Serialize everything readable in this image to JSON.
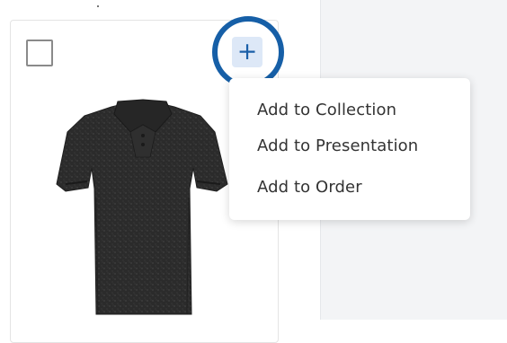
{
  "product_card": {
    "add_button_symbol": "+",
    "product_image_icon": "polo-shirt-icon",
    "shirt_color": "#2c2c2c"
  },
  "add_menu": {
    "items": [
      {
        "label": "Add to Collection"
      },
      {
        "label": "Add to Presentation"
      },
      {
        "label": "Add to Order"
      }
    ]
  },
  "colors": {
    "accent_ring": "#165fa7",
    "add_button_bg": "#dde8f7",
    "side_panel_bg": "#f3f4f6"
  }
}
